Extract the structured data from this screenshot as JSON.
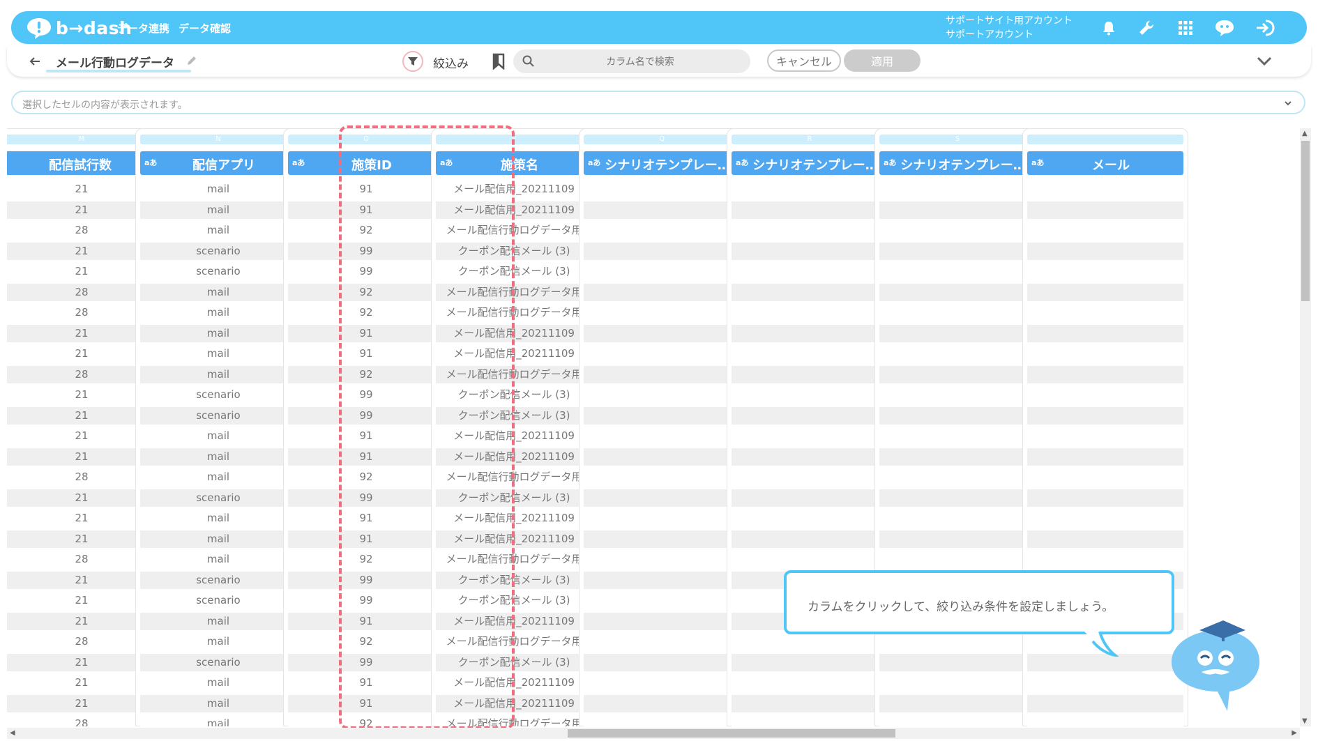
{
  "brand": {
    "name": "b→dash",
    "color": "#4fc6f7"
  },
  "nav": {
    "links": [
      "データ連携",
      "データ確認"
    ]
  },
  "account": {
    "line1": "サポートサイト用アカウント",
    "line2": "サポートアカウント"
  },
  "top_icons": [
    "bell-icon",
    "wrench-icon",
    "apps-grid-icon",
    "support-chat-icon",
    "logout-icon"
  ],
  "toolbar": {
    "page_title": "メール行動ログデータ",
    "filter_label": "絞込み",
    "search_placeholder": "カラム名で検索",
    "cancel_label": "キャンセル",
    "apply_label": "適用"
  },
  "cell_bar": {
    "placeholder": "選択したセルの内容が表示されます。"
  },
  "table": {
    "columns": [
      {
        "letter": "M",
        "type": "",
        "name": "配信試行数",
        "values": [
          "21",
          "21",
          "28",
          "21",
          "21",
          "28",
          "28",
          "21",
          "21",
          "28",
          "21",
          "21",
          "21",
          "21",
          "28",
          "21",
          "21",
          "21",
          "28",
          "21",
          "21",
          "21",
          "28",
          "21",
          "21",
          "21",
          "28"
        ]
      },
      {
        "letter": "N",
        "type": "aあ",
        "name": "配信アプリ",
        "values": [
          "mail",
          "mail",
          "mail",
          "scenario",
          "scenario",
          "mail",
          "mail",
          "mail",
          "mail",
          "mail",
          "scenario",
          "scenario",
          "mail",
          "mail",
          "mail",
          "scenario",
          "mail",
          "mail",
          "mail",
          "scenario",
          "scenario",
          "mail",
          "mail",
          "scenario",
          "mail",
          "mail",
          "mail"
        ]
      },
      {
        "letter": "O",
        "type": "aあ",
        "name": "施策ID",
        "values": [
          "91",
          "91",
          "92",
          "99",
          "99",
          "92",
          "92",
          "91",
          "91",
          "92",
          "99",
          "99",
          "91",
          "91",
          "92",
          "99",
          "91",
          "91",
          "92",
          "99",
          "99",
          "91",
          "92",
          "99",
          "91",
          "91",
          "92"
        ]
      },
      {
        "letter": "P",
        "type": "aあ",
        "name": "施策名",
        "values": [
          "メール配信用_20211109",
          "メール配信用_20211109",
          "メール配信行動ログデータ用",
          "クーポン配信メール (3)",
          "クーポン配信メール (3)",
          "メール配信行動ログデータ用",
          "メール配信行動ログデータ用",
          "メール配信用_20211109",
          "メール配信用_20211109",
          "メール配信行動ログデータ用",
          "クーポン配信メール (3)",
          "クーポン配信メール (3)",
          "メール配信用_20211109",
          "メール配信用_20211109",
          "メール配信行動ログデータ用",
          "クーポン配信メール (3)",
          "メール配信用_20211109",
          "メール配信用_20211109",
          "メール配信行動ログデータ用",
          "クーポン配信メール (3)",
          "クーポン配信メール (3)",
          "メール配信用_20211109",
          "メール配信行動ログデータ用",
          "クーポン配信メール (3)",
          "メール配信用_20211109",
          "メール配信用_20211109",
          "メール配信行動ログデータ用"
        ]
      },
      {
        "letter": "Q",
        "type": "aあ",
        "name": "シナリオテンプレー…",
        "values": []
      },
      {
        "letter": "R",
        "type": "aあ",
        "name": "シナリオテンプレー…",
        "values": []
      },
      {
        "letter": "S",
        "type": "aあ",
        "name": "シナリオテンプレー…",
        "values": []
      },
      {
        "letter": "",
        "type": "aあ",
        "name": "メール",
        "values": []
      }
    ],
    "empty_row_count": 27,
    "highlighted_column": "施策ID"
  },
  "tooltip": {
    "text": "カラムをクリックして、絞り込み条件を設定しましょう。"
  },
  "colors": {
    "highlight": "#ef6f7e",
    "header": "#4fa7f1",
    "accent": "#4fc6f7"
  }
}
